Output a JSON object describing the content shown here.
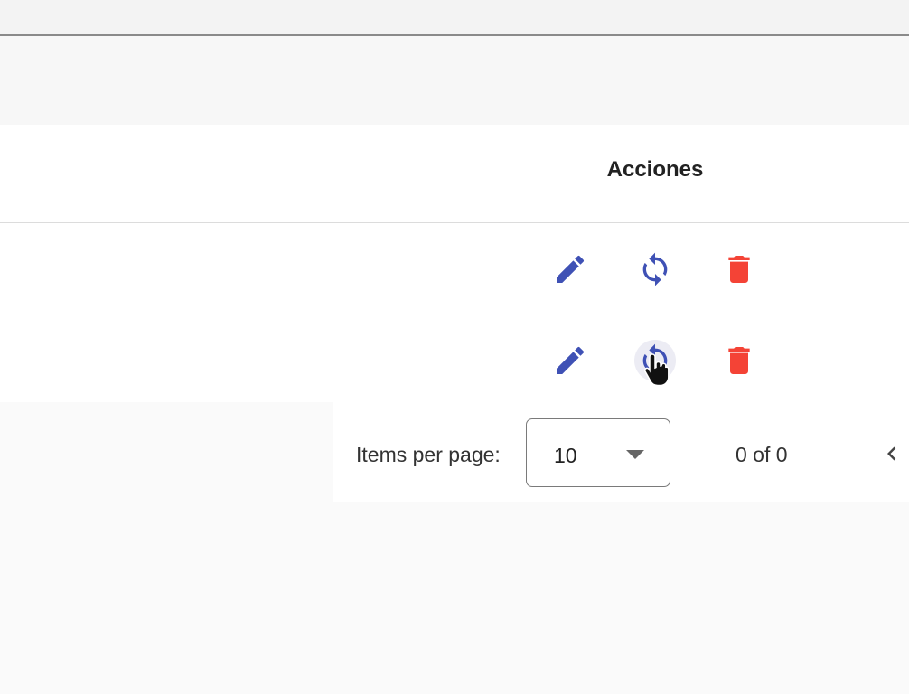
{
  "table": {
    "actions_header": "Acciones",
    "rows": [
      {
        "actions": [
          "edit-icon",
          "sync-icon",
          "delete-icon"
        ]
      },
      {
        "actions": [
          "edit-icon",
          "sync-icon",
          "delete-icon"
        ]
      }
    ]
  },
  "paginator": {
    "items_per_page_label": "Items per page:",
    "page_size": "10",
    "range_label": "0 of 0"
  },
  "colors": {
    "action_blue": "#3f51b5",
    "delete_red": "#f44336"
  }
}
